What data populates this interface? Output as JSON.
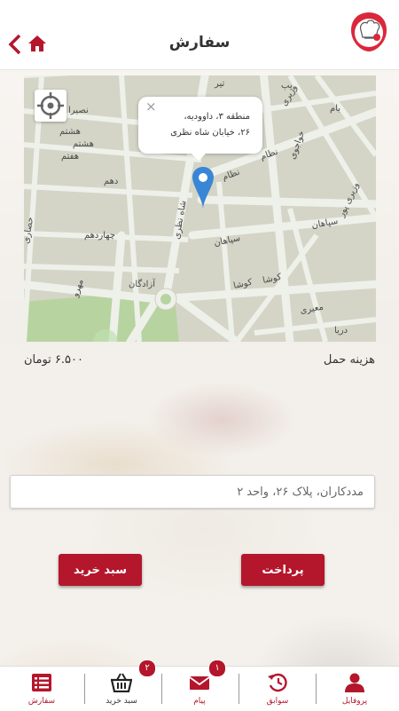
{
  "header": {
    "title": "سفارش",
    "icons": {
      "back": "chevron-left-icon",
      "home": "home-icon",
      "logo": "chef-logo"
    }
  },
  "map": {
    "popup_line1": "منطقه ۳، داوودیه،",
    "popup_line2": "۲۶، خیابان شاه نظری",
    "popup_close": "×",
    "street_labels": [
      "تیر",
      "یپ",
      "نصیرا",
      "هشتم",
      "هشتم",
      "هفتم",
      "وزیری",
      "بام",
      "خواجوی",
      "حصاری",
      "دهم",
      "شاه نظری",
      "نظام",
      "نظام",
      "وزیری پور",
      "چهاردهم",
      "سپاهان",
      "سپاهان",
      "آزادگان",
      "مهرو",
      "کوشا",
      "کوشا",
      "معیری",
      "دریا"
    ]
  },
  "shipping": {
    "label": "هزینه حمل",
    "value": "۶.۵۰۰ تومان"
  },
  "address": {
    "value": "مددکاران، پلاک ۲۶، واحد ۲"
  },
  "buttons": {
    "cart": "سبد خرید",
    "pay": "پرداخت"
  },
  "nav": {
    "items": [
      {
        "label": "سفارش",
        "icon": "list-icon"
      },
      {
        "label": "سبد خرید",
        "icon": "basket-icon",
        "badge": "۲"
      },
      {
        "label": "پیام",
        "icon": "envelope-icon",
        "badge": "۱"
      },
      {
        "label": "سوابق",
        "icon": "history-icon"
      },
      {
        "label": "پروفایل",
        "icon": "user-icon"
      }
    ]
  },
  "colors": {
    "accent": "#b4162c",
    "map_bg": "#d4d5c7",
    "road": "#eef0ea"
  }
}
